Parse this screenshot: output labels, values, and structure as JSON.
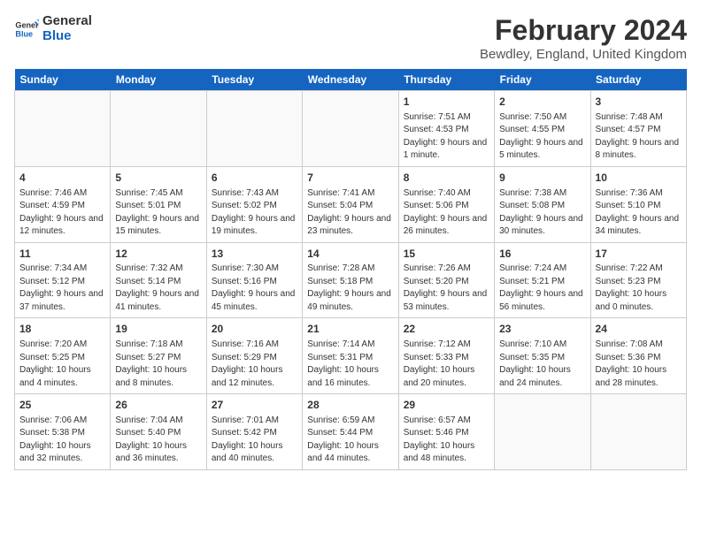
{
  "header": {
    "logo_general": "General",
    "logo_blue": "Blue",
    "month_year": "February 2024",
    "location": "Bewdley, England, United Kingdom"
  },
  "weekdays": [
    "Sunday",
    "Monday",
    "Tuesday",
    "Wednesday",
    "Thursday",
    "Friday",
    "Saturday"
  ],
  "weeks": [
    [
      {
        "day": "",
        "info": ""
      },
      {
        "day": "",
        "info": ""
      },
      {
        "day": "",
        "info": ""
      },
      {
        "day": "",
        "info": ""
      },
      {
        "day": "1",
        "info": "Sunrise: 7:51 AM\nSunset: 4:53 PM\nDaylight: 9 hours and 1 minute."
      },
      {
        "day": "2",
        "info": "Sunrise: 7:50 AM\nSunset: 4:55 PM\nDaylight: 9 hours and 5 minutes."
      },
      {
        "day": "3",
        "info": "Sunrise: 7:48 AM\nSunset: 4:57 PM\nDaylight: 9 hours and 8 minutes."
      }
    ],
    [
      {
        "day": "4",
        "info": "Sunrise: 7:46 AM\nSunset: 4:59 PM\nDaylight: 9 hours and 12 minutes."
      },
      {
        "day": "5",
        "info": "Sunrise: 7:45 AM\nSunset: 5:01 PM\nDaylight: 9 hours and 15 minutes."
      },
      {
        "day": "6",
        "info": "Sunrise: 7:43 AM\nSunset: 5:02 PM\nDaylight: 9 hours and 19 minutes."
      },
      {
        "day": "7",
        "info": "Sunrise: 7:41 AM\nSunset: 5:04 PM\nDaylight: 9 hours and 23 minutes."
      },
      {
        "day": "8",
        "info": "Sunrise: 7:40 AM\nSunset: 5:06 PM\nDaylight: 9 hours and 26 minutes."
      },
      {
        "day": "9",
        "info": "Sunrise: 7:38 AM\nSunset: 5:08 PM\nDaylight: 9 hours and 30 minutes."
      },
      {
        "day": "10",
        "info": "Sunrise: 7:36 AM\nSunset: 5:10 PM\nDaylight: 9 hours and 34 minutes."
      }
    ],
    [
      {
        "day": "11",
        "info": "Sunrise: 7:34 AM\nSunset: 5:12 PM\nDaylight: 9 hours and 37 minutes."
      },
      {
        "day": "12",
        "info": "Sunrise: 7:32 AM\nSunset: 5:14 PM\nDaylight: 9 hours and 41 minutes."
      },
      {
        "day": "13",
        "info": "Sunrise: 7:30 AM\nSunset: 5:16 PM\nDaylight: 9 hours and 45 minutes."
      },
      {
        "day": "14",
        "info": "Sunrise: 7:28 AM\nSunset: 5:18 PM\nDaylight: 9 hours and 49 minutes."
      },
      {
        "day": "15",
        "info": "Sunrise: 7:26 AM\nSunset: 5:20 PM\nDaylight: 9 hours and 53 minutes."
      },
      {
        "day": "16",
        "info": "Sunrise: 7:24 AM\nSunset: 5:21 PM\nDaylight: 9 hours and 56 minutes."
      },
      {
        "day": "17",
        "info": "Sunrise: 7:22 AM\nSunset: 5:23 PM\nDaylight: 10 hours and 0 minutes."
      }
    ],
    [
      {
        "day": "18",
        "info": "Sunrise: 7:20 AM\nSunset: 5:25 PM\nDaylight: 10 hours and 4 minutes."
      },
      {
        "day": "19",
        "info": "Sunrise: 7:18 AM\nSunset: 5:27 PM\nDaylight: 10 hours and 8 minutes."
      },
      {
        "day": "20",
        "info": "Sunrise: 7:16 AM\nSunset: 5:29 PM\nDaylight: 10 hours and 12 minutes."
      },
      {
        "day": "21",
        "info": "Sunrise: 7:14 AM\nSunset: 5:31 PM\nDaylight: 10 hours and 16 minutes."
      },
      {
        "day": "22",
        "info": "Sunrise: 7:12 AM\nSunset: 5:33 PM\nDaylight: 10 hours and 20 minutes."
      },
      {
        "day": "23",
        "info": "Sunrise: 7:10 AM\nSunset: 5:35 PM\nDaylight: 10 hours and 24 minutes."
      },
      {
        "day": "24",
        "info": "Sunrise: 7:08 AM\nSunset: 5:36 PM\nDaylight: 10 hours and 28 minutes."
      }
    ],
    [
      {
        "day": "25",
        "info": "Sunrise: 7:06 AM\nSunset: 5:38 PM\nDaylight: 10 hours and 32 minutes."
      },
      {
        "day": "26",
        "info": "Sunrise: 7:04 AM\nSunset: 5:40 PM\nDaylight: 10 hours and 36 minutes."
      },
      {
        "day": "27",
        "info": "Sunrise: 7:01 AM\nSunset: 5:42 PM\nDaylight: 10 hours and 40 minutes."
      },
      {
        "day": "28",
        "info": "Sunrise: 6:59 AM\nSunset: 5:44 PM\nDaylight: 10 hours and 44 minutes."
      },
      {
        "day": "29",
        "info": "Sunrise: 6:57 AM\nSunset: 5:46 PM\nDaylight: 10 hours and 48 minutes."
      },
      {
        "day": "",
        "info": ""
      },
      {
        "day": "",
        "info": ""
      }
    ]
  ]
}
